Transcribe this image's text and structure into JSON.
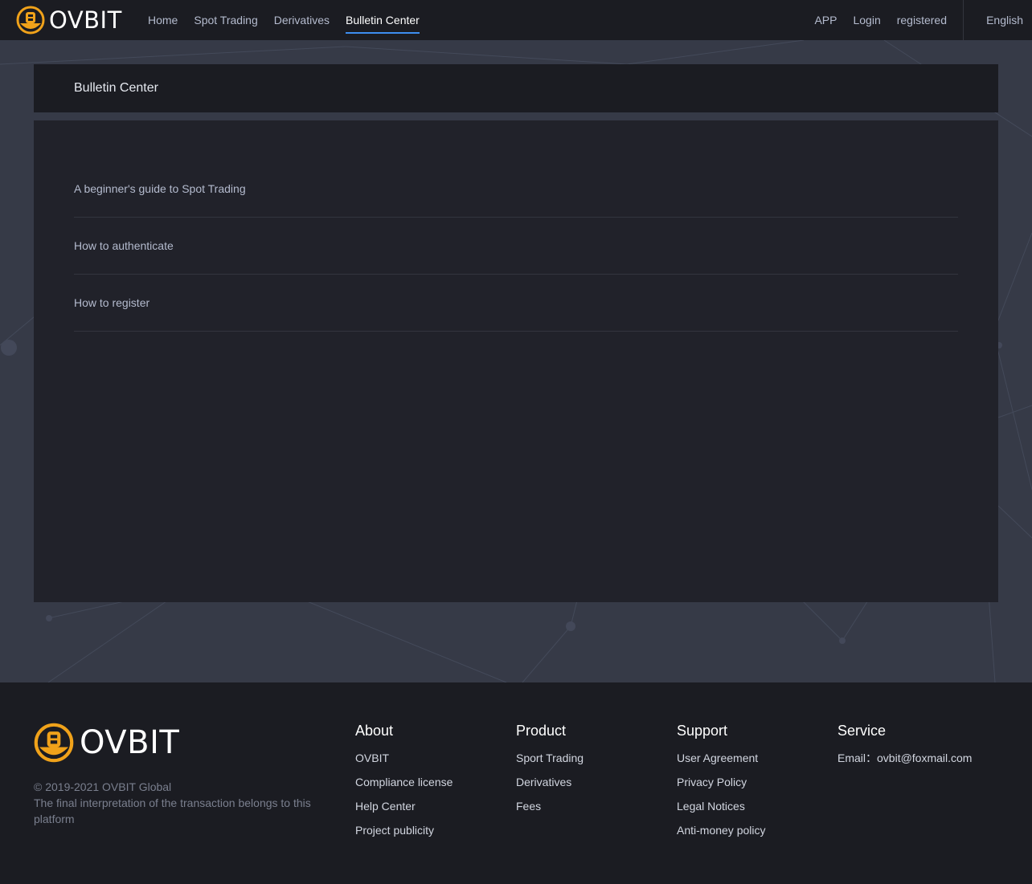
{
  "brand": {
    "name": "OVBIT",
    "accent_color": "#f0a21a",
    "active_color": "#3d8ef0"
  },
  "nav": {
    "left": [
      {
        "label": "Home",
        "active": false
      },
      {
        "label": "Spot Trading",
        "active": false
      },
      {
        "label": "Derivatives",
        "active": false
      },
      {
        "label": "Bulletin Center",
        "active": true
      }
    ],
    "app_label": "APP",
    "login_label": "Login",
    "register_label": "registered",
    "language_label": "English"
  },
  "page": {
    "title": "Bulletin Center",
    "articles": [
      {
        "title": "A beginner's guide to Spot Trading"
      },
      {
        "title": "How to authenticate"
      },
      {
        "title": "How to register"
      }
    ]
  },
  "footer": {
    "brand": "OVBIT",
    "copyright": "© 2019-2021 OVBIT Global",
    "disclaimer": "The final interpretation of the transaction belongs to this platform",
    "columns": [
      {
        "heading": "About",
        "links": [
          "OVBIT",
          "Compliance license",
          "Help Center",
          "Project publicity"
        ]
      },
      {
        "heading": "Product",
        "links": [
          "Sport Trading",
          "Derivatives",
          "Fees"
        ]
      },
      {
        "heading": "Support",
        "links": [
          "User Agreement",
          "Privacy Policy",
          "Legal Notices",
          "Anti-money policy"
        ]
      },
      {
        "heading": "Service",
        "links": [
          "Email：ovbit@foxmail.com"
        ]
      }
    ]
  }
}
